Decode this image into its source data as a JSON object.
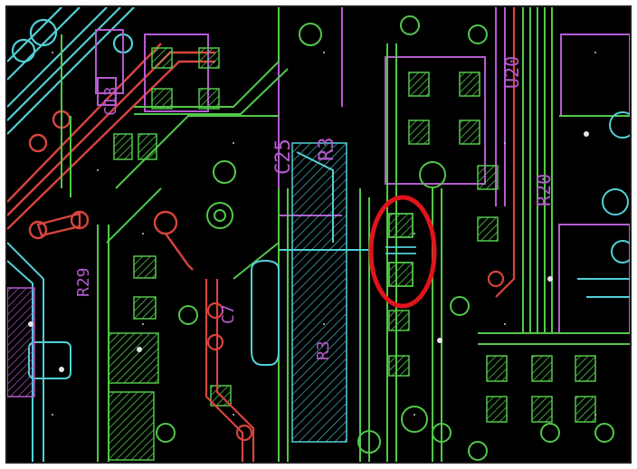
{
  "viewer": {
    "background_color": "#000000",
    "frame_color": "#1a1a1a"
  },
  "layers": {
    "copper_top": "#52c84a",
    "silkscreen": "#b65bd0",
    "copper_bottom": "#53cfd6",
    "drill_outline": "#d8443f",
    "grid_dot": "#c8c8c8"
  },
  "silk_labels": {
    "ref_c25": "C25",
    "ref_r3": "R3",
    "ref_c13": "C13",
    "ref_u20": "U20",
    "ref_r20": "R20",
    "ref_r3b": "R3",
    "ref_r29": "R29",
    "ref_c7": "C7"
  },
  "highlight": {
    "color": "#e0141a",
    "stroke_px": 5,
    "target": "component-pad-pair"
  }
}
